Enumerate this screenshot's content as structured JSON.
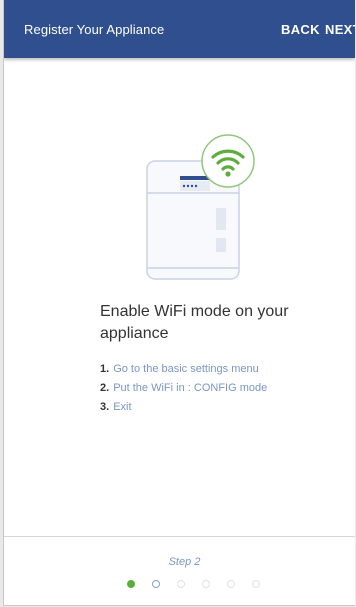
{
  "header": {
    "title": "Register Your Appliance",
    "back_label": "BACK",
    "next_label": "NEXT"
  },
  "main": {
    "heading": "Enable WiFi mode on your appliance",
    "steps": [
      {
        "num": "1.",
        "text": "Go to the basic settings menu"
      },
      {
        "num": "2.",
        "text": "Put the WiFi in : CONFIG mode"
      },
      {
        "num": "3.",
        "text": "Exit"
      }
    ]
  },
  "footer": {
    "step_label": "Step 2",
    "current_step": 2,
    "total_steps": 6
  },
  "colors": {
    "header_bg": "#2f4f8f",
    "accent_green": "#5cae3a",
    "link_blue": "#7a96c4"
  },
  "icons": {
    "appliance": "dishwasher-icon",
    "wifi": "wifi-icon"
  }
}
